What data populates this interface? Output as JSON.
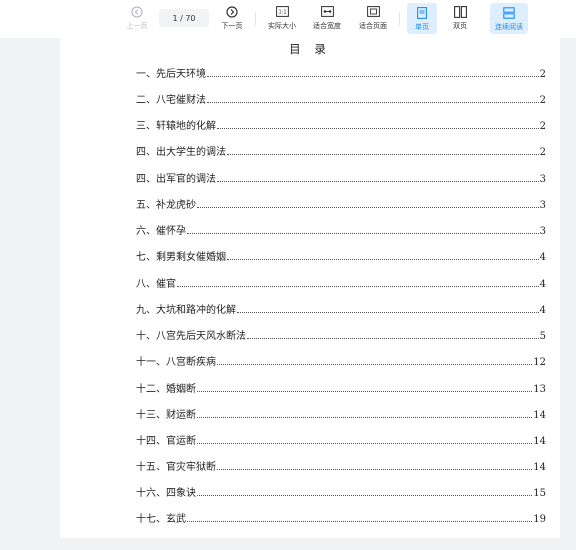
{
  "toolbar": {
    "prev_label": "上一页",
    "page_indicator": "1 / 70",
    "next_label": "下一页",
    "actual_size_label": "实际大小",
    "fit_width_label": "适合宽度",
    "fit_page_label": "适合页面",
    "single_page_label": "单页",
    "double_page_label": "双页",
    "continuous_label": "连续阅读",
    "accent_color": "#1a8cff"
  },
  "document": {
    "title": "目 录",
    "toc": [
      {
        "title": "一、先后天环境",
        "page": "2"
      },
      {
        "title": "二、八宅催财法",
        "page": "2"
      },
      {
        "title": "三、轩辕地的化解",
        "page": "2"
      },
      {
        "title": "四、出大学生的调法",
        "page": "2"
      },
      {
        "title": "四、出军官的调法",
        "page": "3"
      },
      {
        "title": "五、补龙虎砂",
        "page": "3"
      },
      {
        "title": "六、催怀孕",
        "page": "3"
      },
      {
        "title": "七、剩男剩女催婚姻",
        "page": "4"
      },
      {
        "title": "八、催官",
        "page": "4"
      },
      {
        "title": "九、大坑和路冲的化解",
        "page": "4"
      },
      {
        "title": "十、八宫先后天风水断法",
        "page": "5"
      },
      {
        "title": "十一、八宫断疾病",
        "page": "12"
      },
      {
        "title": "十二、婚姻断",
        "page": "13"
      },
      {
        "title": "十三、财运断",
        "page": "14"
      },
      {
        "title": "十四、官运断",
        "page": "14"
      },
      {
        "title": "十五、官灾牢狱断",
        "page": "14"
      },
      {
        "title": "十六、四象诀",
        "page": "15"
      },
      {
        "title": "十七、玄武",
        "page": "19"
      }
    ]
  }
}
